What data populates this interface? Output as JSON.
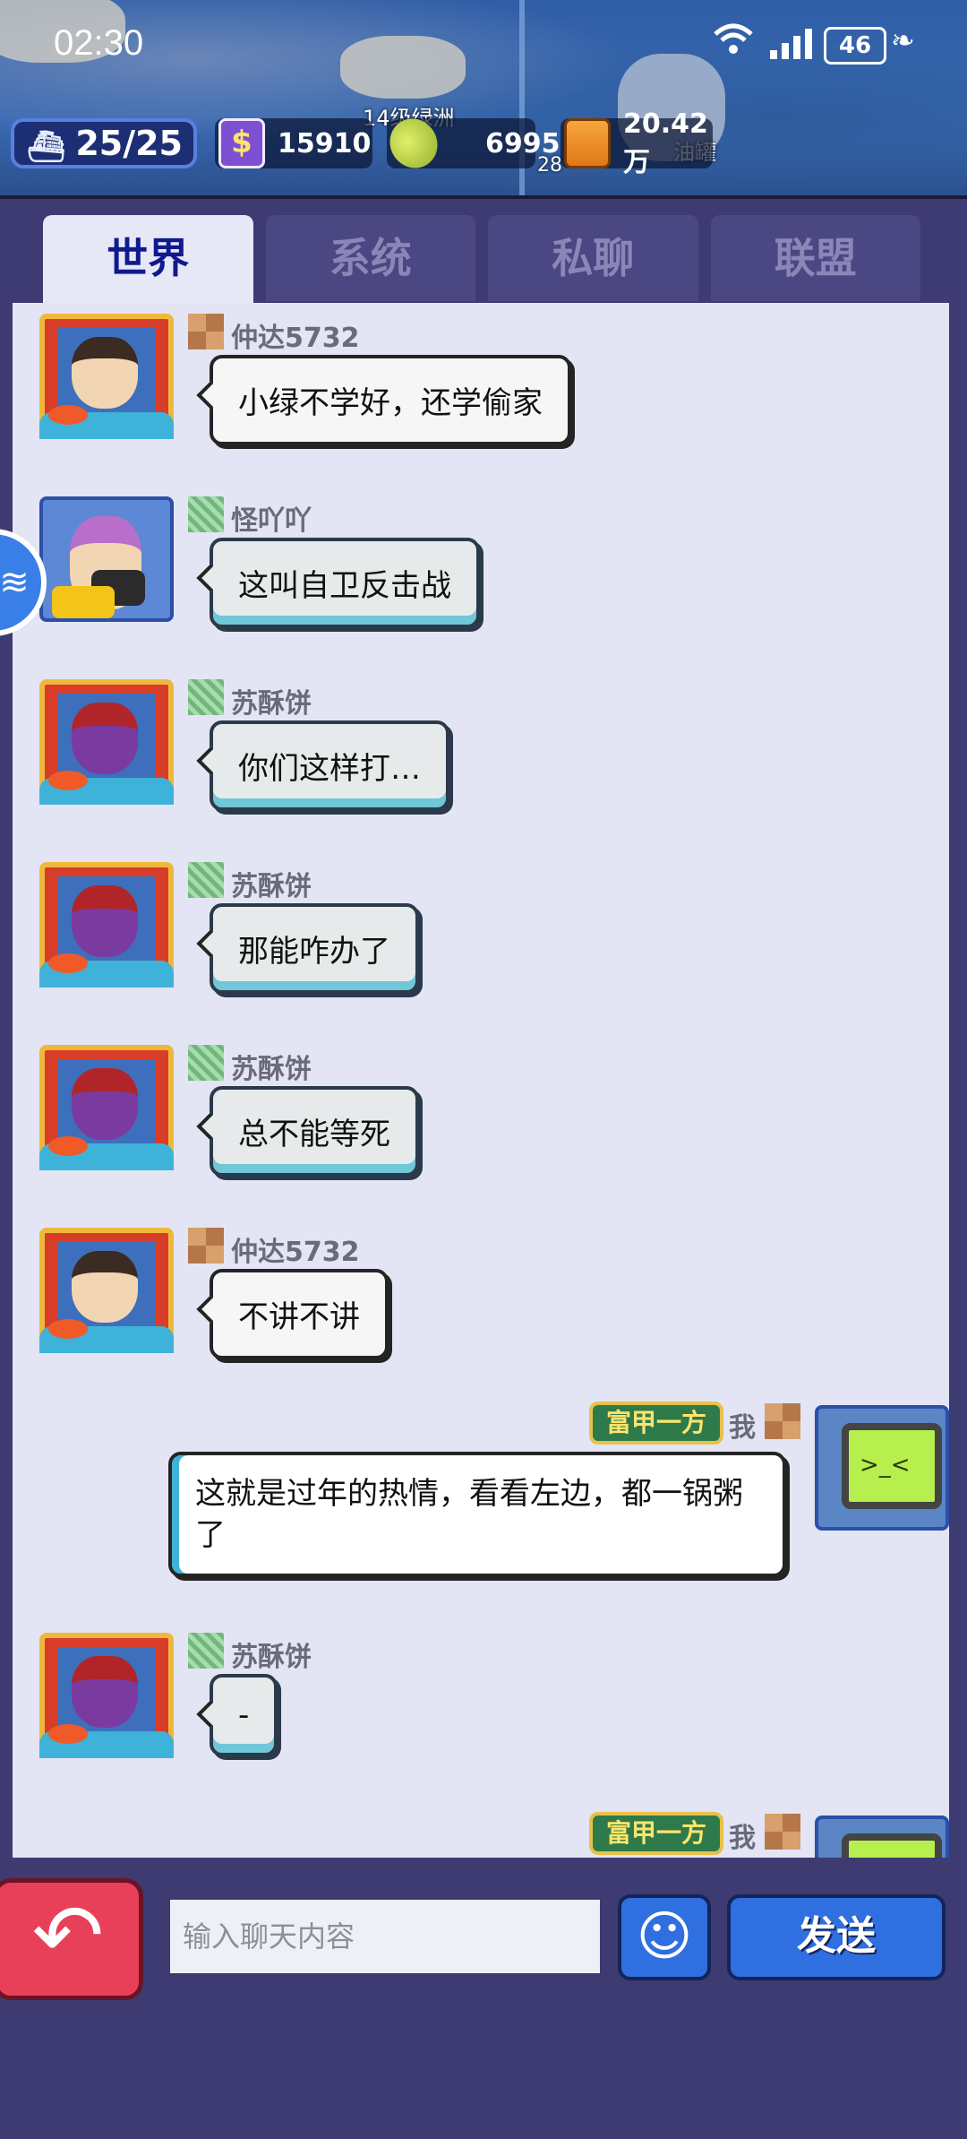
{
  "status_bar": {
    "time": "02:30",
    "battery": "46"
  },
  "resources": {
    "fleet": "25/25",
    "tokens": "15910",
    "coins": "6995",
    "fuel": "20.42万",
    "map_label_oasis": "14级绿洲",
    "map_label_tank": "油罐",
    "map_level": "28"
  },
  "tabs": [
    {
      "label": "世界",
      "active": true
    },
    {
      "label": "系统",
      "active": false
    },
    {
      "label": "私聊",
      "active": false
    },
    {
      "label": "联盟",
      "active": false
    }
  ],
  "messages": [
    {
      "name": "仲达5732",
      "text": "小绿不学好，还学偷家"
    },
    {
      "name": "怪吖吖",
      "text": "这叫自卫反击战"
    },
    {
      "name": "苏酥饼",
      "text": "你们这样打…"
    },
    {
      "name": "苏酥饼",
      "text": "那能咋办了"
    },
    {
      "name": "苏酥饼",
      "text": "总不能等死"
    },
    {
      "name": "仲达5732",
      "text": "不讲不讲"
    },
    {
      "name": "我",
      "title": "富甲一方",
      "text": "这就是过年的热情，看看左边，都一锅粥了"
    },
    {
      "name": "苏酥饼",
      "text": "-"
    },
    {
      "name": "我",
      "title": "富甲一方",
      "text": ""
    }
  ],
  "input": {
    "placeholder": "输入聊天内容"
  },
  "buttons": {
    "send": "发送"
  },
  "colors": {
    "active_tab_text": "#101a8e",
    "send_button": "#2f6fe0",
    "back_button": "#e9405a"
  }
}
